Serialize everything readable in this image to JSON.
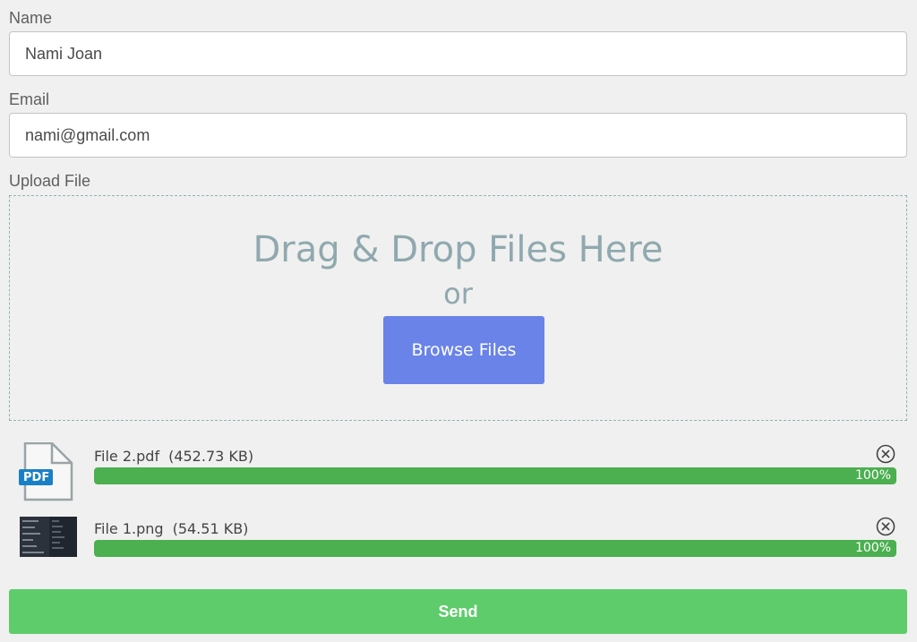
{
  "form": {
    "name_label": "Name",
    "name_value": "Nami Joan",
    "email_label": "Email",
    "email_value": "nami@gmail.com",
    "upload_label": "Upload File"
  },
  "dropzone": {
    "title": "Drag & Drop Files Here",
    "or": "or",
    "browse_label": "Browse Files"
  },
  "files": [
    {
      "name": "File 2.pdf",
      "size": "(452.73 KB)",
      "progress_text": "100%",
      "progress": 1.0,
      "type_badge": "PDF",
      "icon": "pdf-file-icon"
    },
    {
      "name": "File 1.png",
      "size": "(54.51 KB)",
      "progress_text": "100%",
      "progress": 1.0,
      "icon": "image-thumbnail"
    }
  ],
  "send_label": "Send",
  "colors": {
    "accent": "#6a83e8",
    "progress": "#4caf50",
    "send": "#5fcc6c",
    "dropzone_text": "#8fa9ae"
  }
}
